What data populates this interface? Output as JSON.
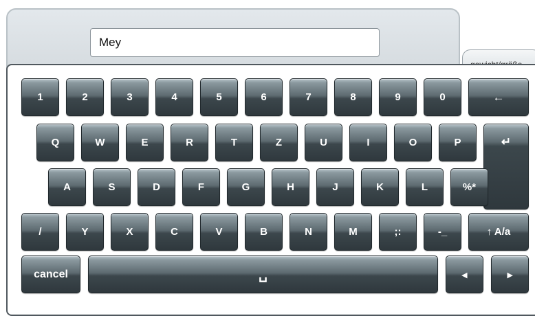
{
  "search": {
    "value": "Mey"
  },
  "side_tab": {
    "label": "gewicht/größe"
  },
  "keyboard": {
    "row_numbers": [
      "1",
      "2",
      "3",
      "4",
      "5",
      "6",
      "7",
      "8",
      "9",
      "0"
    ],
    "backspace": "←",
    "row_q": [
      "Q",
      "W",
      "E",
      "R",
      "T",
      "Z",
      "U",
      "I",
      "O",
      "P"
    ],
    "enter": "↵",
    "row_a": [
      "A",
      "S",
      "D",
      "F",
      "G",
      "H",
      "J",
      "K",
      "L",
      "%*"
    ],
    "row_y": [
      "/",
      "Y",
      "X",
      "C",
      "V",
      "B",
      "N",
      "M",
      ";:",
      "-_"
    ],
    "shift": "↑ A/a",
    "cancel": "cancel",
    "space": "␣",
    "left": "◂",
    "right": "▸"
  }
}
